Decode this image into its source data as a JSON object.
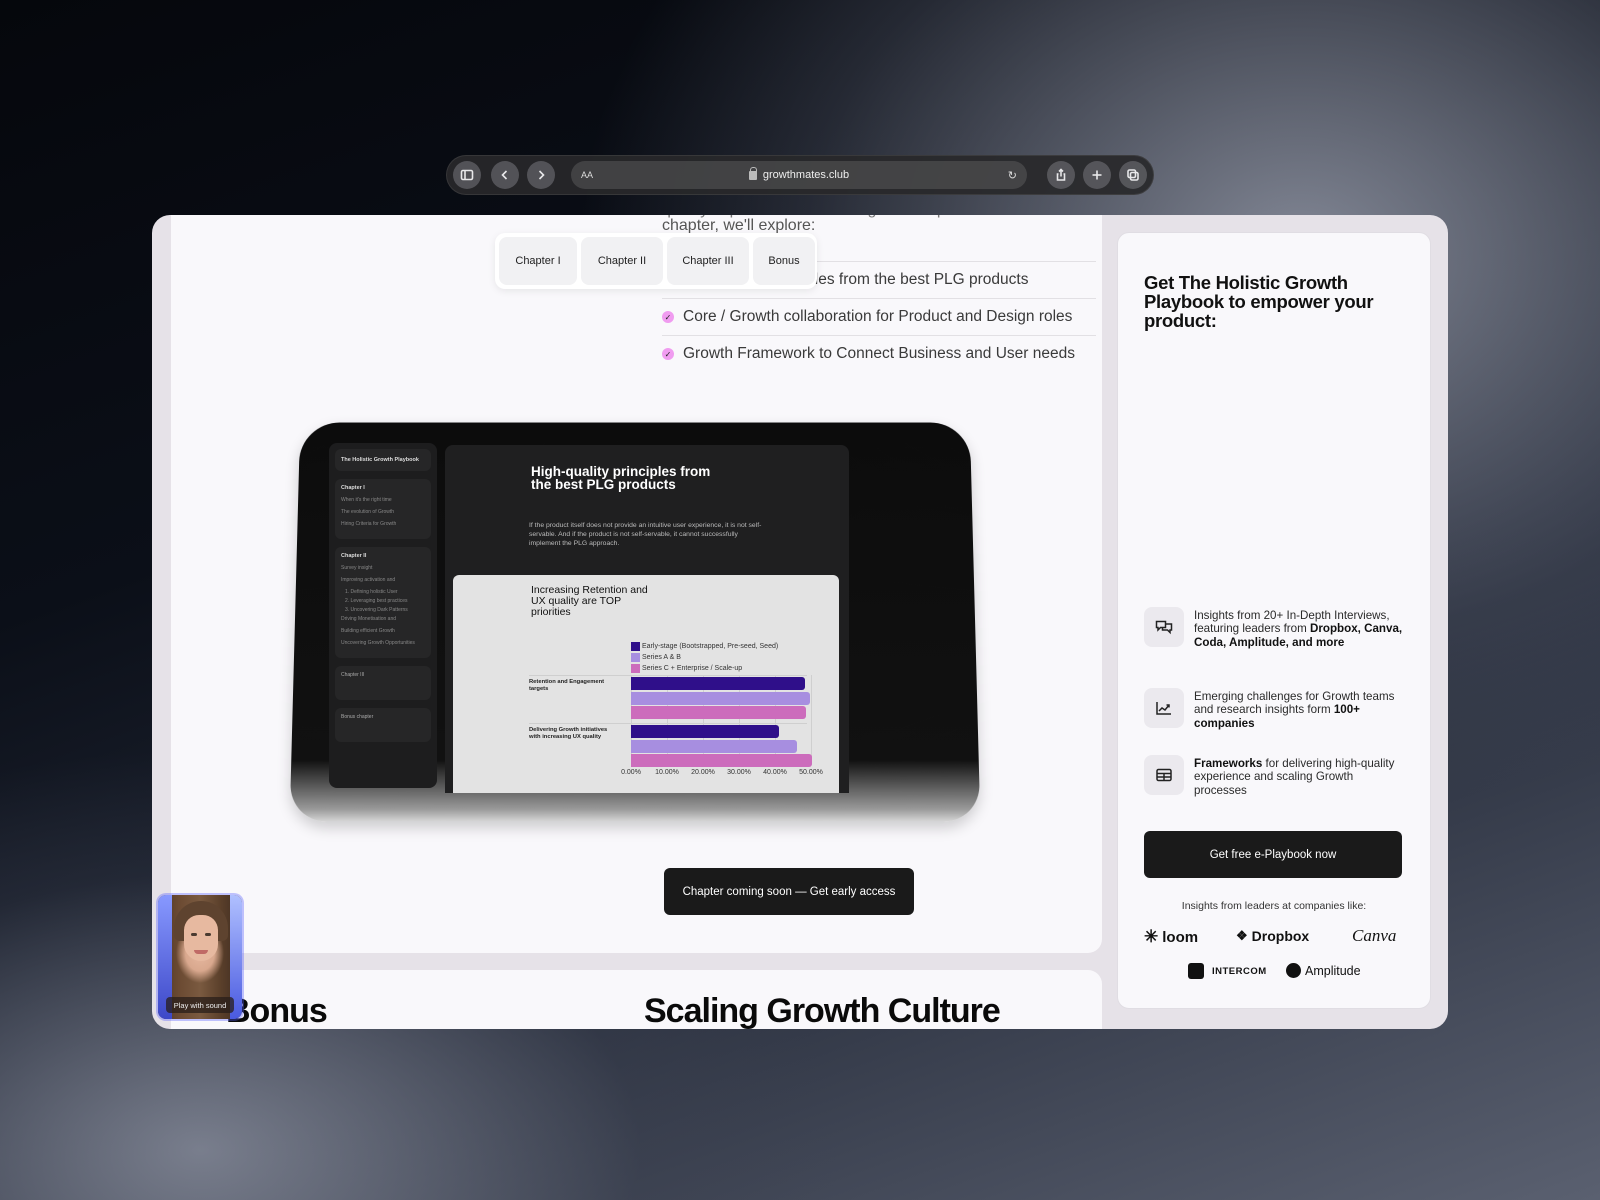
{
  "browser": {
    "url": "growthmates.club",
    "text_size_label": "AA",
    "icons": [
      "sidebar-icon",
      "back-icon",
      "forward-icon",
      "lock-icon",
      "reload-icon",
      "share-icon",
      "new-tab-icon",
      "tabs-overview-icon"
    ]
  },
  "main": {
    "intro_partial_top": "quality experience and scaling Growth processes. In this",
    "intro_partial": "chapter, we'll explore:",
    "chapter_tabs": [
      {
        "label": "Chapter I"
      },
      {
        "label": "Chapter II"
      },
      {
        "label": "Chapter III"
      },
      {
        "label": "Bonus"
      }
    ],
    "checklist": [
      {
        "text": "High-quality principles from the best PLG products"
      },
      {
        "text": "Core / Growth collaboration for Product and Design roles"
      },
      {
        "text": "Growth Framework to Connect Business and User needs"
      }
    ],
    "cta_label": "Chapter coming soon — Get early access",
    "next_section_left": "Bonus",
    "next_section_title": "Scaling Growth Culture",
    "video": {
      "label": "Play with sound"
    }
  },
  "tablet": {
    "sidebar": {
      "book_title": "The Holistic Growth Playbook",
      "chapters": [
        {
          "title": "Chapter I",
          "items": [
            "When it's the right time",
            "The evolution of Growth",
            "Hiring Criteria for Growth"
          ]
        },
        {
          "title": "Chapter II",
          "items": [
            "Survey insight",
            "Improving activation and",
            "1. Defining holistic User",
            "2. Leveraging best practices",
            "3. Uncovering Dark Patterns",
            "Driving Monetisation and",
            "Building efficient Growth",
            "Uncovering Growth Opportunities"
          ]
        },
        {
          "title": "Chapter III",
          "items": []
        },
        {
          "title": "Bonus chapter",
          "items": []
        }
      ]
    },
    "doc": {
      "title": "High-quality principles from the best PLG products",
      "description": "If the product itself does not provide an intuitive user experience, it is not self-servable. And if the product is not self-servable, it cannot successfully implement the PLG approach."
    }
  },
  "chart_data": {
    "type": "bar",
    "orientation": "horizontal",
    "title": "Increasing Retention and UX quality are TOP priorities",
    "categories": [
      "Retention and Engagement targets",
      "Delivering Growth initiatives with increasing UX quality"
    ],
    "series": [
      {
        "name": "Early-stage (Bootstrapped, Pre-seed, Seed)",
        "color": "#2f0f8a",
        "values": [
          48.3,
          41.0
        ]
      },
      {
        "name": "Series A & B",
        "color": "#a78ee0",
        "values": [
          49.7,
          46.0
        ]
      },
      {
        "name": "Series C + Enterprise / Scale-up",
        "color": "#cc6cbc",
        "values": [
          48.6,
          50.3
        ]
      }
    ],
    "xlim": [
      0,
      50
    ],
    "xticks": [
      "0.00%",
      "10.00%",
      "20.00%",
      "30.00%",
      "40.00%",
      "50.00%"
    ],
    "xlabel": "",
    "ylabel": "",
    "legend": "top",
    "grid": true
  },
  "sidebar": {
    "title": "Get The Holistic Growth Playbook to empower your product:",
    "features": [
      {
        "icon": "chat-bubbles-icon",
        "text_plain": "Insights from 20+ In-Depth Interviews, featuring leaders from ",
        "text_bold": "Dropbox, Canva, Coda, Amplitude, and more",
        "text_after": ""
      },
      {
        "icon": "trend-chart-icon",
        "text_plain": "Emerging challenges for Growth teams and research insights form ",
        "text_bold": "100+ companies",
        "text_after": ""
      },
      {
        "icon": "table-icon",
        "text_plain": "",
        "text_bold": "Frameworks",
        "text_after": " for delivering high-quality experience and scaling Growth processes"
      }
    ],
    "cta_label": "Get free e-Playbook now",
    "companies_label": "Insights from leaders at companies like:",
    "logos": [
      "loom",
      "Dropbox",
      "Canva",
      "INTERCOM",
      "Amplitude"
    ]
  }
}
